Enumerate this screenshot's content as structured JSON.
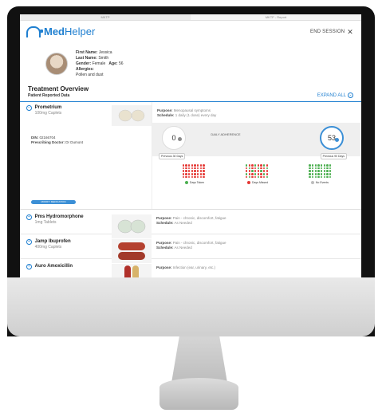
{
  "browser": {
    "tabs": [
      "MKTP",
      "MKTP - Report"
    ]
  },
  "header": {
    "logo_bold": "Med",
    "logo_light": "Helper",
    "end_session": "END SESSION",
    "close_glyph": "✕"
  },
  "patient": {
    "first_name_label": "First Name:",
    "first_name": "Jessica",
    "last_name_label": "Last Name:",
    "last_name": "Smith",
    "gender_label": "Gender:",
    "gender": "Female",
    "age_label": "Age:",
    "age": "56",
    "allergies_label": "Allergies:",
    "allergies": "Pollen and dust"
  },
  "overview": {
    "title": "Treatment Overview",
    "subtitle": "Patient Reported Data",
    "expand_all": "EXPAND ALL"
  },
  "expanded_med": {
    "name": "Prometrium",
    "form": "100mg Caplets",
    "din_label": "DIN:",
    "din": "02166704",
    "doctor_label": "Prescribing Doctor:",
    "doctor": "Dr Dumont",
    "modify_button": "MODIFY MEDICATION",
    "purpose_label": "Purpose:",
    "purpose": "Menopausal symptoms",
    "schedule_label": "Schedule:",
    "schedule": "1 daily (1 dose) every day",
    "adherence": {
      "left_value": "0",
      "left_label": "Previous 30 Days",
      "center_label": "DAILY ADHERENCE",
      "right_value": "53",
      "right_label": "Previous 90 Days"
    },
    "legend": {
      "taken": "Days Taken",
      "missed": "Days Missed",
      "no_events": "No Events"
    },
    "colors": {
      "taken": "#4caf50",
      "missed": "#e53935",
      "no_events": "#bdbdbd"
    }
  },
  "meds": [
    {
      "name": "Pms Hydromorphone",
      "form": "1mg Tablets",
      "purpose_label": "Purpose:",
      "purpose": "Pain - chronic, discomfort, fatigue",
      "schedule_label": "Schedule:",
      "schedule": "As Needed"
    },
    {
      "name": "Jamp Ibuprofen",
      "form": "400mg Caplets",
      "purpose_label": "Purpose:",
      "purpose": "Pain - chronic, discomfort, fatigue",
      "schedule_label": "Schedule:",
      "schedule": "As Needed"
    },
    {
      "name": "Auro Amoxicillin",
      "form": "",
      "purpose_label": "Purpose:",
      "purpose": "Infection (ear, urinary, etc.)",
      "schedule_label": "",
      "schedule": ""
    }
  ]
}
